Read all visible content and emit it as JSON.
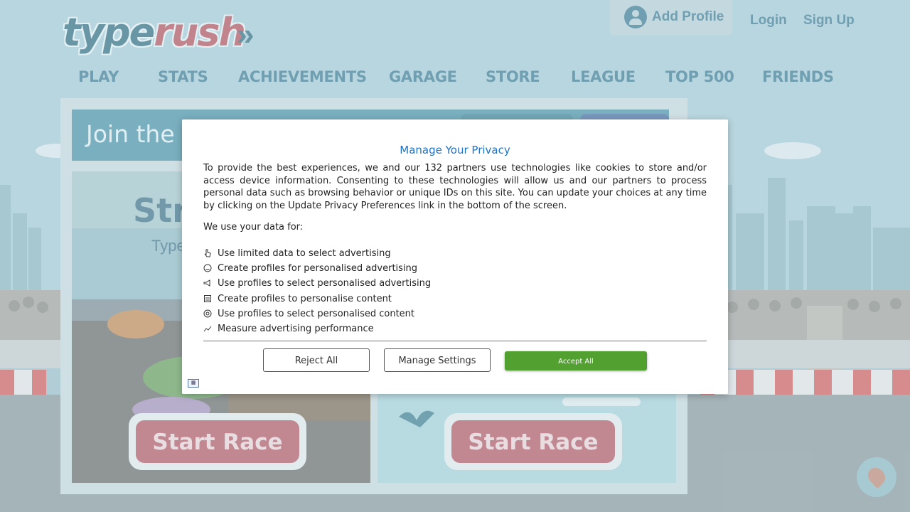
{
  "header": {
    "logo": {
      "part1": "type",
      "part2": "rush",
      "arrows": "»"
    },
    "add_profile_label": "Add Profile",
    "login_label": "Login",
    "signup_label": "Sign Up"
  },
  "nav": {
    "items": [
      {
        "label": "PLAY"
      },
      {
        "label": "STATS"
      },
      {
        "label": "ACHIEVEMENTS"
      },
      {
        "label": "GARAGE"
      },
      {
        "label": "STORE"
      },
      {
        "label": "LEAGUE"
      },
      {
        "label": "TOP 500"
      },
      {
        "label": "FRIENDS"
      }
    ]
  },
  "main": {
    "banner_text": "Join the g",
    "card_left": {
      "title": "Stre",
      "subtitle": "Type",
      "button": "Start Race"
    },
    "card_right": {
      "button": "Start Race"
    }
  },
  "privacy_modal": {
    "title": "Manage Your Privacy",
    "description": "To provide the best experiences, we and our 132 partners use technologies like cookies to store and/or access device information. Consenting to these technologies will allow us and our partners to process personal data such as browsing behavior or unique IDs on this site. You can update your choices at any time by clicking on the Update Privacy Preferences link in the bottom of the screen.",
    "use_data_heading": "We use your data for:",
    "purposes": [
      {
        "label": "Use limited data to select advertising",
        "icon": "pointer-icon"
      },
      {
        "label": "Create profiles for personalised advertising",
        "icon": "face-icon"
      },
      {
        "label": "Use profiles to select personalised advertising",
        "icon": "megaphone-icon"
      },
      {
        "label": "Create profiles to personalise content",
        "icon": "document-icon"
      },
      {
        "label": "Use profiles to select personalised content",
        "icon": "target-icon"
      },
      {
        "label": "Measure advertising performance",
        "icon": "trend-icon"
      }
    ],
    "buttons": {
      "reject": "Reject All",
      "manage": "Manage Settings",
      "accept": "Accept All"
    },
    "colors": {
      "title": "#1e73c5",
      "accept": "#52a030"
    }
  },
  "colors": {
    "brand_teal": "#3b7a92",
    "brand_red": "#b7505a",
    "start_race": "#b65763"
  }
}
